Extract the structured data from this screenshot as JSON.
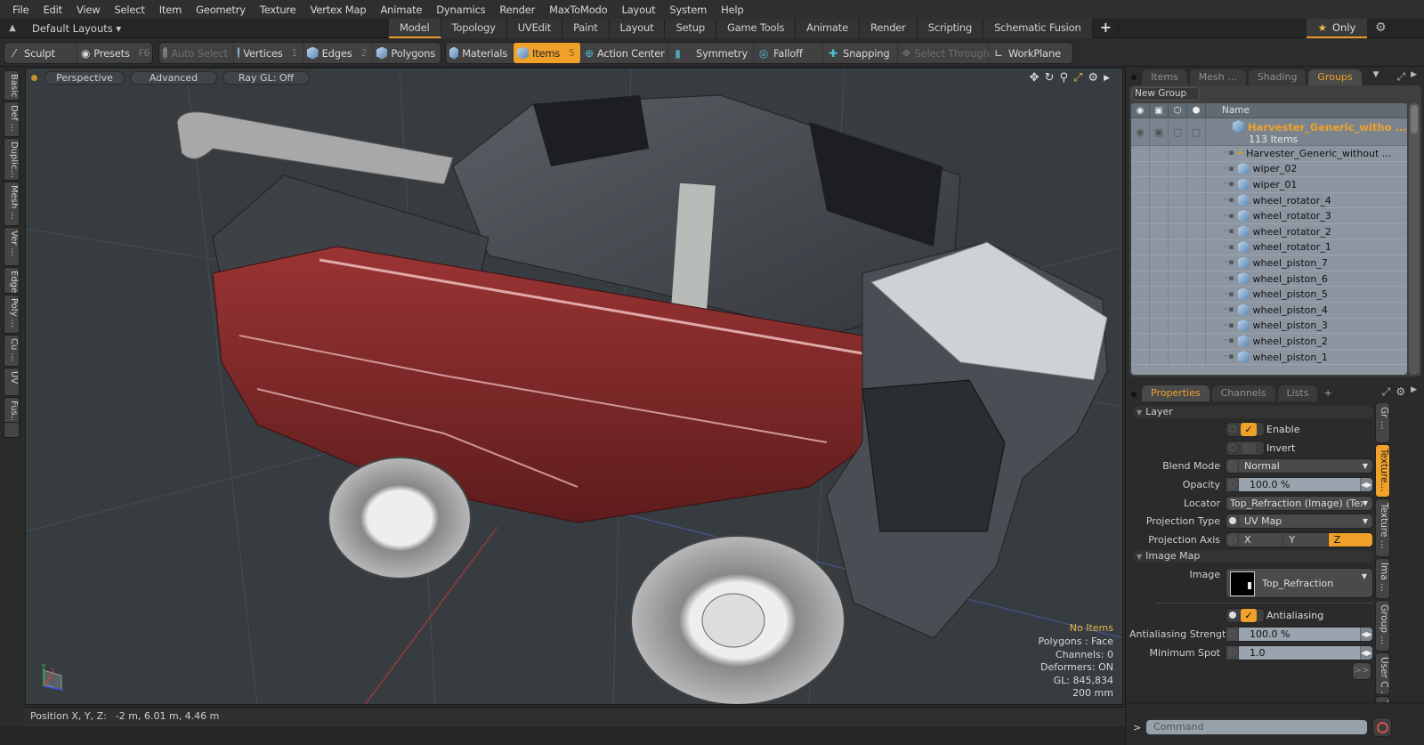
{
  "menu": [
    "File",
    "Edit",
    "View",
    "Select",
    "Item",
    "Geometry",
    "Texture",
    "Vertex Map",
    "Animate",
    "Dynamics",
    "Render",
    "MaxToModo",
    "Layout",
    "System",
    "Help"
  ],
  "layout_bar": {
    "layouts_label": "Default Layouts ▾",
    "tabs": [
      "Model",
      "Topology",
      "UVEdit",
      "Paint",
      "Layout",
      "Setup",
      "Game Tools",
      "Animate",
      "Render",
      "Scripting",
      "Schematic Fusion"
    ],
    "active_tab": "Model",
    "add_tab": "+",
    "only_label": "Only"
  },
  "toolbar": {
    "sculpt": "Sculpt",
    "presets": "Presets",
    "presets_key": "F6",
    "auto_select": "Auto Select",
    "vertices": "Vertices",
    "vertices_key": "1",
    "edges": "Edges",
    "edges_key": "2",
    "polygons": "Polygons",
    "materials": "Materials",
    "items": "Items",
    "items_key": "5",
    "action_center": "Action Center",
    "symmetry": "Symmetry",
    "falloff": "Falloff",
    "snapping": "Snapping",
    "select_through": "Select Through",
    "workplane": "WorkPlane"
  },
  "left_tabs": [
    "Basic",
    "Def ...",
    "Duplic...",
    "Mesh ...",
    "Ver ...",
    "Edge",
    "Poly ...",
    "Cu ...",
    "UV",
    "Fus..."
  ],
  "viewport": {
    "view_mode": "Perspective",
    "shading": "Advanced",
    "raygl": "Ray GL: Off",
    "hud": {
      "selection": "No Items",
      "polygons": "Polygons : Face",
      "channels": "Channels: 0",
      "deformers": "Deformers: ON",
      "gl": "GL: 845,834",
      "scale": "200 mm"
    }
  },
  "status": {
    "label": "Position X, Y, Z:",
    "value": "-2 m, 6.01 m, 4.46 m"
  },
  "groups_panel": {
    "tabs": [
      "Items",
      "Mesh ...",
      "Shading",
      "Groups"
    ],
    "active_tab": "Groups",
    "new_group": "New Group",
    "name_header": "Name",
    "group_name": "Harvester_Generic_witho ...",
    "group_count": "113 Items",
    "items": [
      {
        "name": "Harvester_Generic_without ...",
        "type": "locator"
      },
      {
        "name": "wiper_02",
        "type": "mesh"
      },
      {
        "name": "wiper_01",
        "type": "mesh"
      },
      {
        "name": "wheel_rotator_4",
        "type": "mesh"
      },
      {
        "name": "wheel_rotator_3",
        "type": "mesh"
      },
      {
        "name": "wheel_rotator_2",
        "type": "mesh"
      },
      {
        "name": "wheel_rotator_1",
        "type": "mesh"
      },
      {
        "name": "wheel_piston_7",
        "type": "mesh"
      },
      {
        "name": "wheel_piston_6",
        "type": "mesh"
      },
      {
        "name": "wheel_piston_5",
        "type": "mesh"
      },
      {
        "name": "wheel_piston_4",
        "type": "mesh"
      },
      {
        "name": "wheel_piston_3",
        "type": "mesh"
      },
      {
        "name": "wheel_piston_2",
        "type": "mesh"
      },
      {
        "name": "wheel_piston_1",
        "type": "mesh"
      }
    ]
  },
  "properties_panel": {
    "tabs": [
      "Properties",
      "Channels",
      "Lists"
    ],
    "active_tab": "Properties",
    "add_tab": "+",
    "layer_section": "Layer",
    "enable_label": "Enable",
    "enable_checked": true,
    "invert_label": "Invert",
    "invert_checked": false,
    "blend_mode_label": "Blend Mode",
    "blend_mode": "Normal",
    "opacity_label": "Opacity",
    "opacity": "100.0 %",
    "locator_label": "Locator",
    "locator": "Top_Refraction (Image) (Tex ...",
    "projection_type_label": "Projection Type",
    "projection_type": "UV Map",
    "projection_axis_label": "Projection Axis",
    "projection_axis_options": [
      "X",
      "Y",
      "Z"
    ],
    "projection_axis": "Z",
    "image_map_section": "Image Map",
    "image_label": "Image",
    "image": "Top_Refraction",
    "antialiasing_label": "Antialiasing",
    "antialiasing_checked": true,
    "aa_strength_label": "Antialiasing Strength",
    "aa_strength": "100.0 %",
    "min_spot_label": "Minimum Spot",
    "min_spot": "1.0",
    "more": ">>",
    "side_tabs": [
      "Gr ...",
      "Texture...",
      "Texture ...",
      "Ima ...",
      "Group ...",
      "User C ...",
      "Tags"
    ],
    "active_side_tab": "Texture..."
  },
  "command": {
    "prompt": ">",
    "placeholder": "Command"
  },
  "colors": {
    "accent": "#f0a12a",
    "viewport_bg": "#363c40",
    "harvester_red": "#8a2a2a"
  }
}
